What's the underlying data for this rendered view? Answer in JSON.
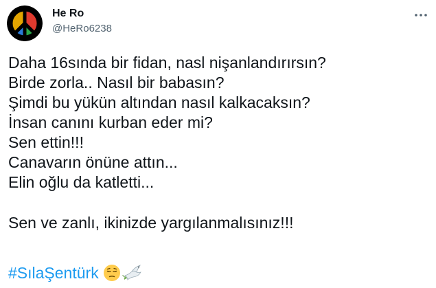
{
  "user": {
    "display_name": "He Ro",
    "handle": "@HeRo6238",
    "avatar_icon": "peace-sign-icon"
  },
  "tweet": {
    "lines": [
      "Daha 16sında bir fidan, nasl nişanlandırırsın?",
      "Birde zorla.. Nasıl bir babasın?",
      "Şimdi bu yükün altından nasıl kalkacaksın?",
      "İnsan canını kurban eder mi?",
      "Sen ettin!!!",
      "Canavarın önüne attın...",
      "Elin oğlu da katletti...",
      "",
      "Sen ve zanlı, ikinizde yargılanmalısınız!!!"
    ],
    "hashtag": "#SılaŞentürk",
    "emojis": [
      "pensive-face-icon",
      "dove-icon"
    ]
  },
  "actions": {
    "more_icon": "more-horizontal-icon"
  },
  "colors": {
    "text": "#0f1419",
    "secondary": "#536471",
    "link": "#1d9bf0"
  }
}
